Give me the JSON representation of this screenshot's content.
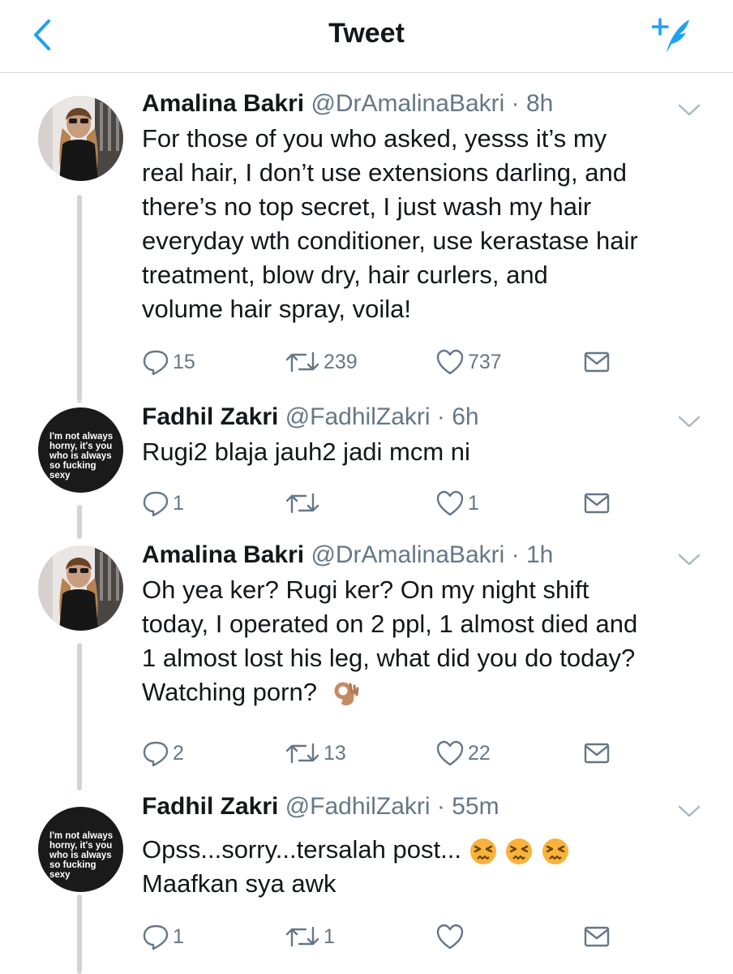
{
  "header": {
    "title": "Tweet",
    "back_icon": "chevron-left-icon",
    "compose_icon": "compose-tweet-icon"
  },
  "colors": {
    "accent": "#1da1f2",
    "muted": "#657786",
    "text": "#14171a",
    "thread_line": "#ccd6dd"
  },
  "tweets": [
    {
      "name": "Amalina Bakri",
      "handle": "@DrAmalinaBakri",
      "time": "· 8h",
      "lines": [
        "For those of you who asked, yesss it’s my",
        "real hair, I don’t use extensions darling, and",
        "there’s no top secret, I just wash my hair",
        "everyday wth conditioner, use kerastase hair",
        "treatment, blow dry, hair curlers, and",
        "volume hair spray, voila!"
      ],
      "replies": "15",
      "retweets": "239",
      "likes": "737"
    },
    {
      "name": "Fadhil Zakri",
      "handle": "@FadhilZakri",
      "time": "· 6h",
      "lines": [
        "Rugi2 blaja jauh2 jadi mcm ni"
      ],
      "avatar_text": "I'm not always horny, it's you who is always so fucking sexy",
      "replies": "1",
      "retweets": "",
      "likes": "1"
    },
    {
      "name": "Amalina Bakri",
      "handle": "@DrAmalinaBakri",
      "time": "· 1h",
      "lines": [
        "Oh yea ker? Rugi ker? On my night shift",
        "today, I operated on 2 ppl, 1 almost died and",
        "1 almost lost his leg, what did you do today?",
        "Watching porn?"
      ],
      "emoji_names": [
        "ok-hand-emoji"
      ],
      "replies": "2",
      "retweets": "13",
      "likes": "22"
    },
    {
      "name": "Fadhil Zakri",
      "handle": "@FadhilZakri",
      "time": "· 55m",
      "lines": [
        "Opss...sorry...tersalah post...",
        "Maafkan sya awk"
      ],
      "emoji_names": [
        "persevering-face-emoji",
        "persevering-face-emoji",
        "persevering-face-emoji"
      ],
      "avatar_text": "I'm not always horny, it's you who is always so fucking sexy",
      "replies": "1",
      "retweets": "1",
      "likes": ""
    }
  ]
}
